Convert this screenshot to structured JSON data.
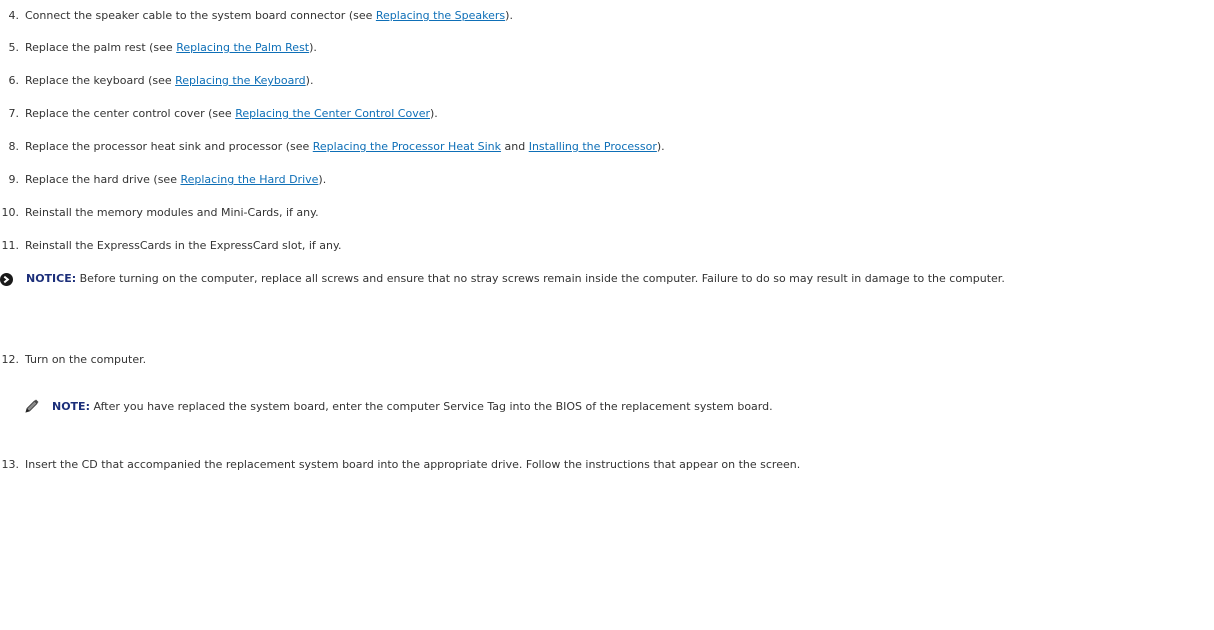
{
  "steps": [
    {
      "num": "4.",
      "pre": "Connect the speaker cable to the system board connector (see ",
      "link": "Replacing the Speakers",
      "post": ")."
    },
    {
      "num": "5.",
      "pre": "Replace the palm rest (see ",
      "link": "Replacing the Palm Rest",
      "post": ")."
    },
    {
      "num": "6.",
      "pre": "Replace the keyboard (see ",
      "link": "Replacing the Keyboard",
      "post": ")."
    },
    {
      "num": "7.",
      "pre": "Replace the center control cover (see ",
      "link": "Replacing the Center Control Cover",
      "post": ")."
    },
    {
      "num": "8.",
      "pre": "Replace the processor heat sink and processor (see ",
      "link": "Replacing the Processor Heat Sink",
      "mid": " and ",
      "link2": "Installing the Processor",
      "post": ")."
    },
    {
      "num": "9.",
      "pre": "Replace the hard drive (see ",
      "link": "Replacing the Hard Drive",
      "post": ")."
    },
    {
      "num": "10.",
      "text": "Reinstall the memory modules and Mini-Cards, if any."
    },
    {
      "num": "11.",
      "text": "Reinstall the ExpressCards in the ExpressCard slot, if any."
    },
    {
      "num": "12.",
      "text": "Turn on the computer."
    },
    {
      "num": "13.",
      "text": "Insert the CD that accompanied the replacement system board into the appropriate drive. Follow the instructions that appear on the screen."
    }
  ],
  "notice": {
    "label": "NOTICE:",
    "text": " Before turning on the computer, replace all screws and ensure that no stray screws remain inside the computer. Failure to do so may result in damage to the computer.",
    "icon": "notice-icon"
  },
  "note": {
    "label": "NOTE:",
    "text": " After you have replaced the system board, enter the computer Service Tag into the BIOS of the replacement system board.",
    "icon": "pencil-note-icon"
  },
  "colors": {
    "link": "#0e6fb7",
    "label": "#1c2f7a",
    "text": "#333333"
  }
}
